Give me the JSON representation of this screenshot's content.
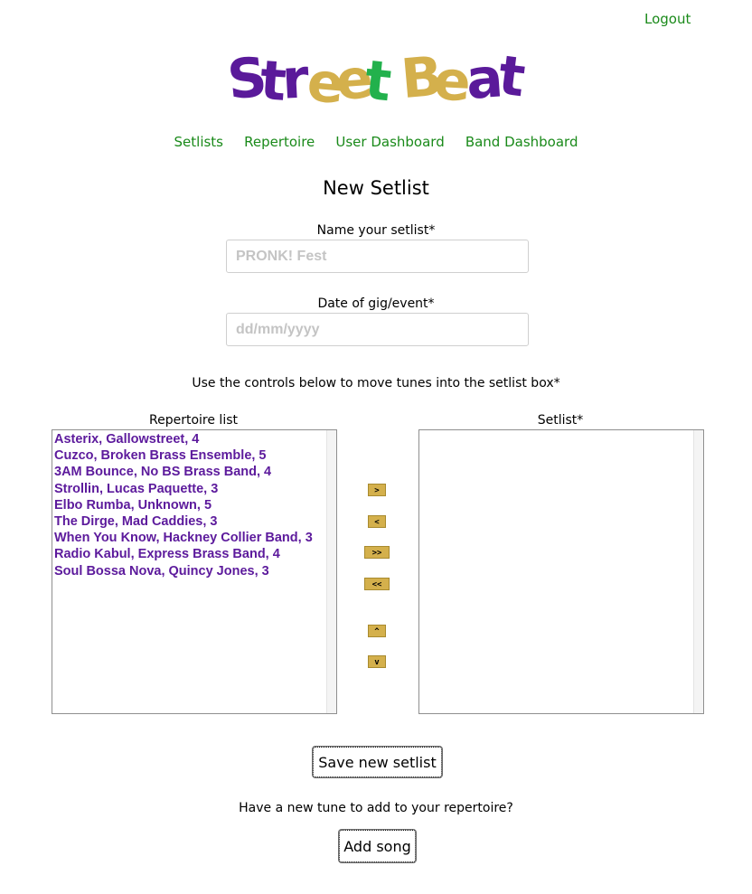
{
  "header": {
    "logout_label": "Logout",
    "logo": {
      "text": "StreetBeat",
      "letters": [
        {
          "ch": "S",
          "color": "#5a1a9a"
        },
        {
          "ch": "t",
          "color": "#5a1a9a"
        },
        {
          "ch": "r",
          "color": "#5a1a9a"
        },
        {
          "ch": "e",
          "color": "#d4b04c"
        },
        {
          "ch": "e",
          "color": "#d4b04c"
        },
        {
          "ch": "t",
          "color": "#22b14c"
        },
        {
          "ch": "B",
          "color": "#d4b04c"
        },
        {
          "ch": "e",
          "color": "#d4b04c"
        },
        {
          "ch": "a",
          "color": "#5a1a9a"
        },
        {
          "ch": "t",
          "color": "#5a1a9a"
        }
      ]
    }
  },
  "nav": {
    "items": [
      "Setlists",
      "Repertoire",
      "User Dashboard",
      "Band Dashboard"
    ]
  },
  "page": {
    "title": "New Setlist",
    "name_label": "Name your setlist*",
    "name_placeholder": "PRONK! Fest",
    "name_value": "",
    "date_label": "Date of gig/event*",
    "date_placeholder": "dd/mm/yyyy",
    "date_value": "",
    "instructions": "Use the controls below to move tunes into the setlist box*"
  },
  "repertoire": {
    "caption": "Repertoire list",
    "items": [
      "Asterix, Gallowstreet, 4",
      "Cuzco, Broken Brass Ensemble, 5",
      "3AM Bounce, No BS Brass Band, 4",
      "Strollin, Lucas Paquette, 3",
      "Elbo Rumba, Unknown, 5",
      "The Dirge, Mad Caddies, 3",
      "When You Know, Hackney Collier Band, 3",
      "Radio Kabul, Express Brass Band, 4",
      "Soul Bossa Nova, Quincy Jones, 3"
    ]
  },
  "setlist": {
    "caption": "Setlist*",
    "items": []
  },
  "controls": {
    "move_right": ">",
    "move_left": "<",
    "move_all_right": ">>",
    "move_all_left": "<<",
    "move_up": "^",
    "move_down": "v"
  },
  "actions": {
    "save_label": "Save new setlist",
    "new_tune_prompt": "Have a new tune to add to your repertoire?",
    "add_song_label": "Add song"
  },
  "colors": {
    "link_green": "#1a8a1a",
    "list_purple": "#5c1a9c",
    "button_gold": "#d4b04c"
  }
}
